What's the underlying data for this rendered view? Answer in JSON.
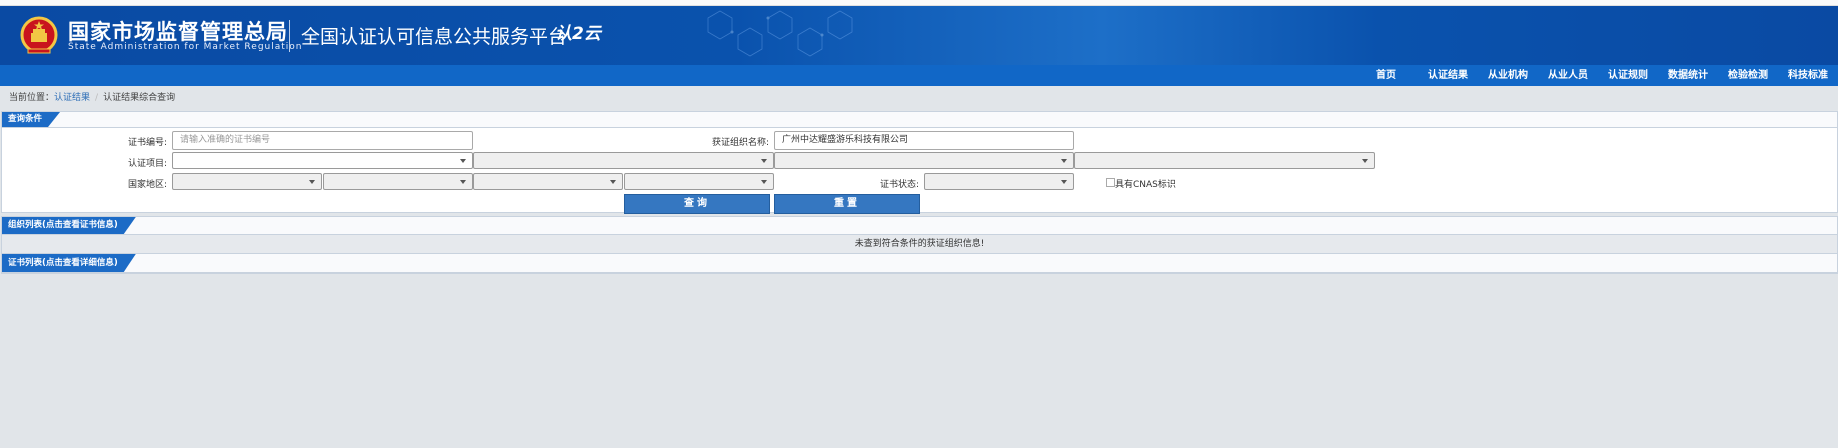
{
  "header": {
    "org_cn": "国家市场监督管理总局",
    "org_en": "State Administration  for  Market Regulation",
    "platform": "全国认证认可信息公共服务平台",
    "logo_text": "认2云"
  },
  "nav": {
    "items": [
      "首页",
      "认证结果",
      "从业机构",
      "从业人员",
      "认证规则",
      "数据统计",
      "检验检测",
      "科技标准"
    ]
  },
  "breadcrumb": {
    "prefix": "当前位置：",
    "level1": "认证结果",
    "level2": "认证结果综合查询"
  },
  "query": {
    "title": "查询条件",
    "cert_no_label": "证书编号:",
    "cert_no_placeholder": "请输入准确的证书编号",
    "org_name_label": "获证组织名称:",
    "org_name_value": "广州中达耀盛游乐科技有限公司",
    "project_label": "认证项目:",
    "region_label": "国家地区:",
    "status_label": "证书状态:",
    "cnas_label": "具有CNAS标识",
    "search_button": "查询",
    "reset_button": "重置"
  },
  "org_list": {
    "title": "组织列表(点击查看证书信息)",
    "empty_message": "未查到符合条件的获证组织信息!"
  },
  "cert_list": {
    "title": "证书列表(点击查看详细信息)"
  },
  "colors": {
    "header_blue": "#0a4aa3",
    "nav_blue": "#1167c7",
    "button_blue": "#3577c1",
    "page_bg": "#e1e5e9"
  }
}
